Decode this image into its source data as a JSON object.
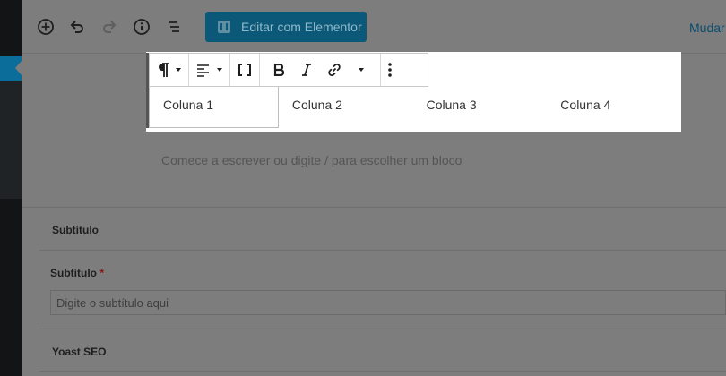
{
  "sidebar": {
    "active_item": "posts"
  },
  "header": {
    "icons": [
      "add-block-icon",
      "undo-icon",
      "redo-icon",
      "info-icon",
      "block-navigation-icon"
    ],
    "elementor_button_label": "Editar com Elementor",
    "switch_link_label": "Mudar"
  },
  "toolbar": {
    "icons": [
      "paragraph-icon",
      "align-left-icon",
      "block-bracket-icon",
      "bold-icon",
      "italic-icon",
      "link-icon",
      "more-options-icon"
    ]
  },
  "table": {
    "columns": [
      "Coluna 1",
      "Coluna 2",
      "Coluna 3",
      "Coluna 4"
    ]
  },
  "editor": {
    "placeholder": "Comece a escrever ou digite / para escolher um bloco"
  },
  "meta": {
    "subtitle_box_title": "Subtítulo",
    "subtitle_field_label": "Subtítulo",
    "required_mark": "*",
    "subtitle_placeholder": "Digite o subtítulo aqui",
    "yoast_box_title": "Yoast SEO"
  },
  "colors": {
    "overlay_gray": "#7d7d7d",
    "elementor_blue": "#0c5878",
    "sidebar_dark": "#121416",
    "sidebar_active": "#0a6d9a"
  }
}
